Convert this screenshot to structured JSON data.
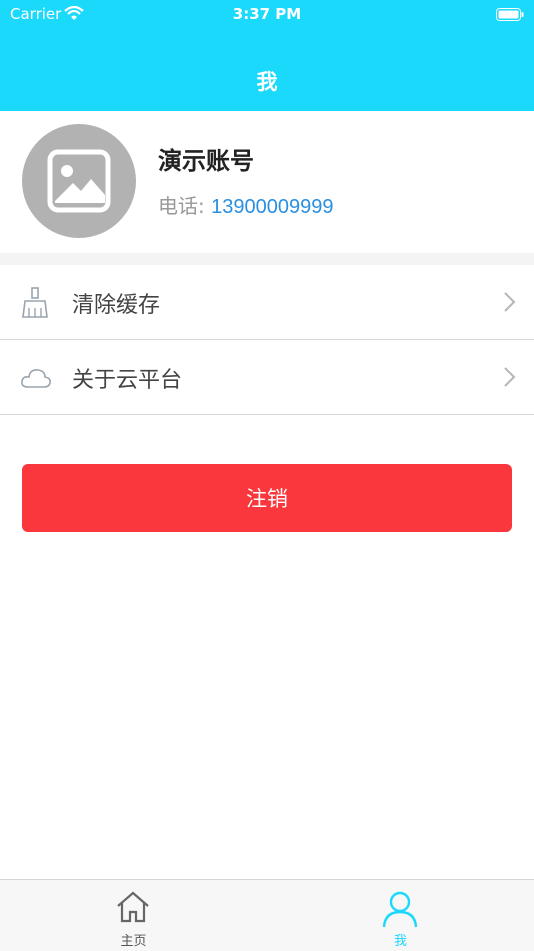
{
  "status_bar": {
    "carrier": "Carrier",
    "time": "3:37 PM"
  },
  "header": {
    "title": "我"
  },
  "profile": {
    "account_name": "演示账号",
    "phone_label": "电话:",
    "phone_value": "13900009999"
  },
  "menu": {
    "items": [
      {
        "label": "清除缓存",
        "icon": "broom-icon"
      },
      {
        "label": "关于云平台",
        "icon": "cloud-icon"
      }
    ]
  },
  "logout": {
    "label": "注销"
  },
  "tabbar": {
    "tabs": [
      {
        "label": "主页",
        "icon": "home-icon"
      },
      {
        "label": "我",
        "icon": "person-icon"
      }
    ]
  },
  "colors": {
    "header_bg": "#1ad9fb",
    "logout_bg": "#f9373d",
    "phone_text": "#2a8fe0",
    "active_tab": "#1ad9fb"
  }
}
